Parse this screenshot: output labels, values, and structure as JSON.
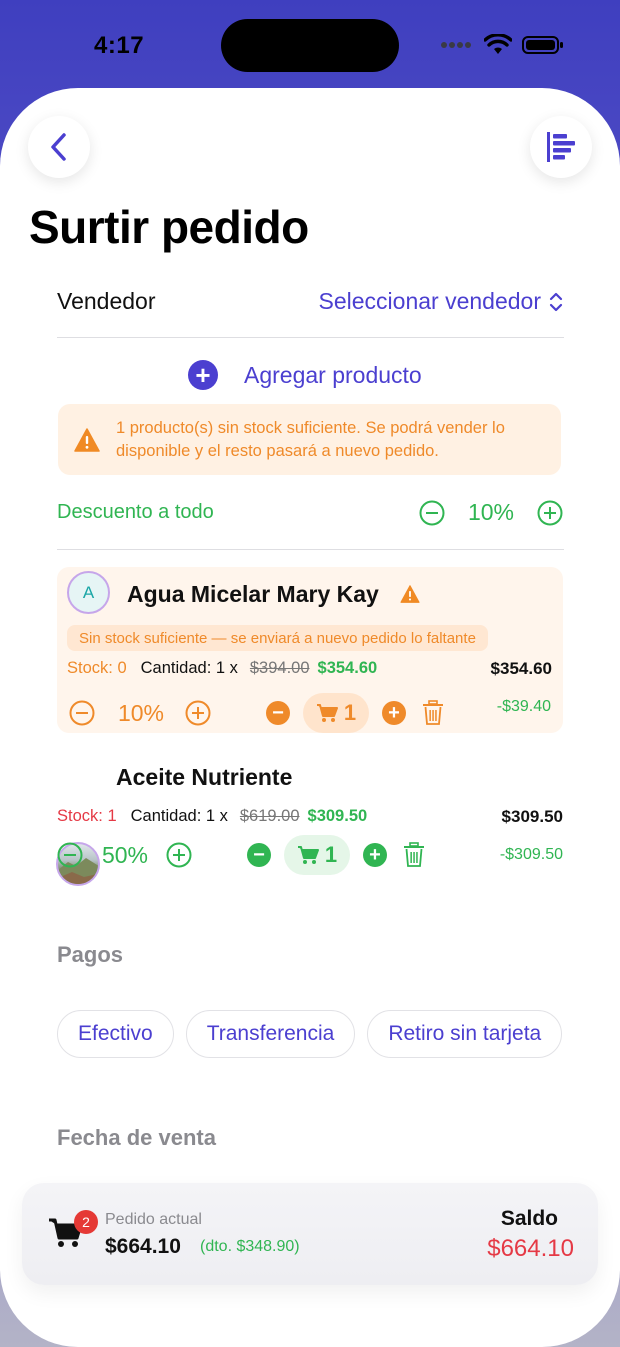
{
  "status": {
    "time": "4:17"
  },
  "header": {
    "title": "Surtir pedido"
  },
  "vendor": {
    "label": "Vendedor",
    "value": "Seleccionar vendedor"
  },
  "add_product": {
    "label": "Agregar producto"
  },
  "warning": {
    "text": "1 producto(s) sin stock suficiente. Se podrá vender lo disponible y el resto pasará a nuevo pedido."
  },
  "discount_all": {
    "label": "Descuento a todo",
    "value": "10%"
  },
  "products": [
    {
      "initial": "A",
      "name": "Agua Micelar Mary Kay",
      "stock_note": "Sin stock suficiente — se enviará a nuevo pedido lo faltante",
      "stock_label": "Stock:",
      "stock_value": "0",
      "qty_text": "Cantidad: 1 x",
      "original_price": "$394.00",
      "price": "$354.60",
      "total": "$354.60",
      "discount": "10%",
      "cart_qty": "1",
      "saving": "-$39.40"
    },
    {
      "name": "Aceite Nutriente",
      "stock_label": "Stock:",
      "stock_value": "1",
      "qty_text": "Cantidad: 1 x",
      "original_price": "$619.00",
      "price": "$309.50",
      "total": "$309.50",
      "discount": "50%",
      "cart_qty": "1",
      "saving": "-$309.50"
    }
  ],
  "payments": {
    "title": "Pagos",
    "options": [
      "Efectivo",
      "Transferencia",
      "Retiro sin tarjeta"
    ]
  },
  "sale_date": {
    "title": "Fecha de venta"
  },
  "footer": {
    "cart_count": "2",
    "order_label": "Pedido actual",
    "order_total": "$664.10",
    "order_discount": "(dto. $348.90)",
    "balance_label": "Saldo",
    "balance_value": "$664.10"
  },
  "colors": {
    "accent": "#4b3fd0",
    "green": "#30b552",
    "orange": "#ef8a2a",
    "red": "#e53945"
  }
}
